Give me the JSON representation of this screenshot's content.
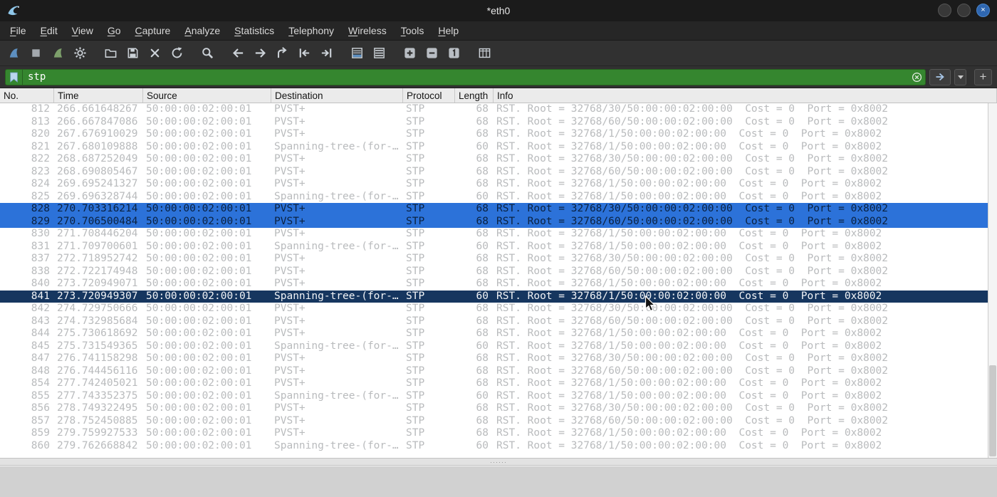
{
  "window": {
    "title": "*eth0",
    "close_glyph": "×"
  },
  "menu": {
    "items": [
      "File",
      "Edit",
      "View",
      "Go",
      "Capture",
      "Analyze",
      "Statistics",
      "Telephony",
      "Wireless",
      "Tools",
      "Help"
    ]
  },
  "toolbar": {
    "groups": [
      [
        "capture-start",
        "capture-stop",
        "capture-restart",
        "capture-options"
      ],
      [
        "open-file",
        "save-file",
        "close-file",
        "reload"
      ],
      [
        "find-packet"
      ],
      [
        "go-back",
        "go-forward",
        "go-to-packet",
        "previous-packet",
        "next-packet"
      ],
      [
        "auto-scroll",
        "colorize"
      ],
      [
        "zoom-in",
        "zoom-out",
        "zoom-original"
      ],
      [
        "resize-columns"
      ]
    ]
  },
  "filter": {
    "value": "stp",
    "add_button_label": "+"
  },
  "splitter": {
    "handle": "······"
  },
  "colors": {
    "filter_valid_bg": "#35862f",
    "multi_select_bg": "#2c72d9",
    "selected_bg": "#16365f",
    "accent_blue": "#5d8fc0"
  },
  "packet_list": {
    "columns": [
      "No.",
      "Time",
      "Source",
      "Destination",
      "Protocol",
      "Length",
      "Info"
    ],
    "rows": [
      {
        "no": "812",
        "time": "266.661648267",
        "source": "50:00:00:02:00:01",
        "destination": "PVST+",
        "protocol": "STP",
        "length": "68",
        "info": "RST. Root = 32768/30/50:00:00:02:00:00  Cost = 0  Port = 0x8002",
        "state": ""
      },
      {
        "no": "813",
        "time": "266.667847086",
        "source": "50:00:00:02:00:01",
        "destination": "PVST+",
        "protocol": "STP",
        "length": "68",
        "info": "RST. Root = 32768/60/50:00:00:02:00:00  Cost = 0  Port = 0x8002",
        "state": ""
      },
      {
        "no": "820",
        "time": "267.676910029",
        "source": "50:00:00:02:00:01",
        "destination": "PVST+",
        "protocol": "STP",
        "length": "68",
        "info": "RST. Root = 32768/1/50:00:00:02:00:00  Cost = 0  Port = 0x8002",
        "state": ""
      },
      {
        "no": "821",
        "time": "267.680109888",
        "source": "50:00:00:02:00:01",
        "destination": "Spanning-tree-(for-…",
        "protocol": "STP",
        "length": "60",
        "info": "RST. Root = 32768/1/50:00:00:02:00:00  Cost = 0  Port = 0x8002",
        "state": ""
      },
      {
        "no": "822",
        "time": "268.687252049",
        "source": "50:00:00:02:00:01",
        "destination": "PVST+",
        "protocol": "STP",
        "length": "68",
        "info": "RST. Root = 32768/30/50:00:00:02:00:00  Cost = 0  Port = 0x8002",
        "state": ""
      },
      {
        "no": "823",
        "time": "268.690805467",
        "source": "50:00:00:02:00:01",
        "destination": "PVST+",
        "protocol": "STP",
        "length": "68",
        "info": "RST. Root = 32768/60/50:00:00:02:00:00  Cost = 0  Port = 0x8002",
        "state": ""
      },
      {
        "no": "824",
        "time": "269.695241327",
        "source": "50:00:00:02:00:01",
        "destination": "PVST+",
        "protocol": "STP",
        "length": "68",
        "info": "RST. Root = 32768/1/50:00:00:02:00:00  Cost = 0  Port = 0x8002",
        "state": ""
      },
      {
        "no": "825",
        "time": "269.696328744",
        "source": "50:00:00:02:00:01",
        "destination": "Spanning-tree-(for-…",
        "protocol": "STP",
        "length": "60",
        "info": "RST. Root = 32768/1/50:00:00:02:00:00  Cost = 0  Port = 0x8002",
        "state": ""
      },
      {
        "no": "828",
        "time": "270.703316214",
        "source": "50:00:00:02:00:01",
        "destination": "PVST+",
        "protocol": "STP",
        "length": "68",
        "info": "RST. Root = 32768/30/50:00:00:02:00:00  Cost = 0  Port = 0x8002",
        "state": "multi-selected"
      },
      {
        "no": "829",
        "time": "270.706500484",
        "source": "50:00:00:02:00:01",
        "destination": "PVST+",
        "protocol": "STP",
        "length": "68",
        "info": "RST. Root = 32768/60/50:00:00:02:00:00  Cost = 0  Port = 0x8002",
        "state": "multi-selected"
      },
      {
        "no": "830",
        "time": "271.708446204",
        "source": "50:00:00:02:00:01",
        "destination": "PVST+",
        "protocol": "STP",
        "length": "68",
        "info": "RST. Root = 32768/1/50:00:00:02:00:00  Cost = 0  Port = 0x8002",
        "state": ""
      },
      {
        "no": "831",
        "time": "271.709700601",
        "source": "50:00:00:02:00:01",
        "destination": "Spanning-tree-(for-…",
        "protocol": "STP",
        "length": "60",
        "info": "RST. Root = 32768/1/50:00:00:02:00:00  Cost = 0  Port = 0x8002",
        "state": ""
      },
      {
        "no": "837",
        "time": "272.718952742",
        "source": "50:00:00:02:00:01",
        "destination": "PVST+",
        "protocol": "STP",
        "length": "68",
        "info": "RST. Root = 32768/30/50:00:00:02:00:00  Cost = 0  Port = 0x8002",
        "state": ""
      },
      {
        "no": "838",
        "time": "272.722174948",
        "source": "50:00:00:02:00:01",
        "destination": "PVST+",
        "protocol": "STP",
        "length": "68",
        "info": "RST. Root = 32768/60/50:00:00:02:00:00  Cost = 0  Port = 0x8002",
        "state": ""
      },
      {
        "no": "840",
        "time": "273.720949071",
        "source": "50:00:00:02:00:01",
        "destination": "PVST+",
        "protocol": "STP",
        "length": "68",
        "info": "RST. Root = 32768/1/50:00:00:02:00:00  Cost = 0  Port = 0x8002",
        "state": ""
      },
      {
        "no": "841",
        "time": "273.720949307",
        "source": "50:00:00:02:00:01",
        "destination": "Spanning-tree-(for-…",
        "protocol": "STP",
        "length": "60",
        "info": "RST. Root = 32768/1/50:00:00:02:00:00  Cost = 0  Port = 0x8002",
        "state": "selected"
      },
      {
        "no": "842",
        "time": "274.729750666",
        "source": "50:00:00:02:00:01",
        "destination": "PVST+",
        "protocol": "STP",
        "length": "68",
        "info": "RST. Root = 32768/30/50:00:00:02:00:00  Cost = 0  Port = 0x8002",
        "state": ""
      },
      {
        "no": "843",
        "time": "274.732985684",
        "source": "50:00:00:02:00:01",
        "destination": "PVST+",
        "protocol": "STP",
        "length": "68",
        "info": "RST. Root = 32768/60/50:00:00:02:00:00  Cost = 0  Port = 0x8002",
        "state": ""
      },
      {
        "no": "844",
        "time": "275.730618692",
        "source": "50:00:00:02:00:01",
        "destination": "PVST+",
        "protocol": "STP",
        "length": "68",
        "info": "RST. Root = 32768/1/50:00:00:02:00:00  Cost = 0  Port = 0x8002",
        "state": ""
      },
      {
        "no": "845",
        "time": "275.731549365",
        "source": "50:00:00:02:00:01",
        "destination": "Spanning-tree-(for-…",
        "protocol": "STP",
        "length": "60",
        "info": "RST. Root = 32768/1/50:00:00:02:00:00  Cost = 0  Port = 0x8002",
        "state": ""
      },
      {
        "no": "847",
        "time": "276.741158298",
        "source": "50:00:00:02:00:01",
        "destination": "PVST+",
        "protocol": "STP",
        "length": "68",
        "info": "RST. Root = 32768/30/50:00:00:02:00:00  Cost = 0  Port = 0x8002",
        "state": ""
      },
      {
        "no": "848",
        "time": "276.744456116",
        "source": "50:00:00:02:00:01",
        "destination": "PVST+",
        "protocol": "STP",
        "length": "68",
        "info": "RST. Root = 32768/60/50:00:00:02:00:00  Cost = 0  Port = 0x8002",
        "state": ""
      },
      {
        "no": "854",
        "time": "277.742405021",
        "source": "50:00:00:02:00:01",
        "destination": "PVST+",
        "protocol": "STP",
        "length": "68",
        "info": "RST. Root = 32768/1/50:00:00:02:00:00  Cost = 0  Port = 0x8002",
        "state": ""
      },
      {
        "no": "855",
        "time": "277.743352375",
        "source": "50:00:00:02:00:01",
        "destination": "Spanning-tree-(for-…",
        "protocol": "STP",
        "length": "60",
        "info": "RST. Root = 32768/1/50:00:00:02:00:00  Cost = 0  Port = 0x8002",
        "state": ""
      },
      {
        "no": "856",
        "time": "278.749322495",
        "source": "50:00:00:02:00:01",
        "destination": "PVST+",
        "protocol": "STP",
        "length": "68",
        "info": "RST. Root = 32768/30/50:00:00:02:00:00  Cost = 0  Port = 0x8002",
        "state": ""
      },
      {
        "no": "857",
        "time": "278.752450885",
        "source": "50:00:00:02:00:01",
        "destination": "PVST+",
        "protocol": "STP",
        "length": "68",
        "info": "RST. Root = 32768/60/50:00:00:02:00:00  Cost = 0  Port = 0x8002",
        "state": ""
      },
      {
        "no": "859",
        "time": "279.759927533",
        "source": "50:00:00:02:00:01",
        "destination": "PVST+",
        "protocol": "STP",
        "length": "68",
        "info": "RST. Root = 32768/1/50:00:00:02:00:00  Cost = 0  Port = 0x8002",
        "state": ""
      },
      {
        "no": "860",
        "time": "279.762668842",
        "source": "50:00:00:02:00:01",
        "destination": "Spanning-tree-(for-…",
        "protocol": "STP",
        "length": "60",
        "info": "RST. Root = 32768/1/50:00:00:02:00:00  Cost = 0  Port = 0x8002",
        "state": ""
      }
    ]
  }
}
